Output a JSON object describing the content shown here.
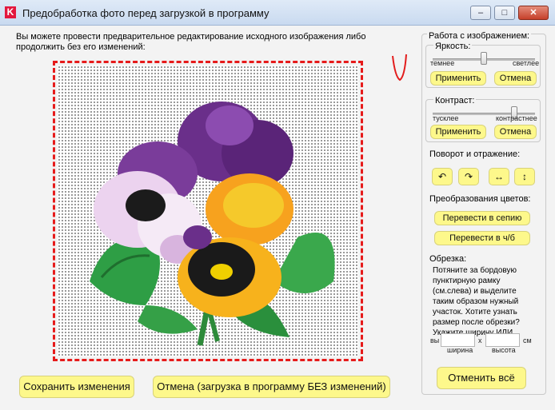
{
  "window": {
    "title": "Предобработка фото перед загрузкой в программу",
    "app_icon_letter": "K",
    "minimize_glyph": "–",
    "maximize_glyph": "□",
    "close_glyph": "✕"
  },
  "intro_text": "Вы можете провести предварительное редактирование исходного изображения либо продолжить без его изменений:",
  "bottom_buttons": {
    "save": "Сохранить изменения",
    "cancel": "Отмена (загрузка в программу БЕЗ изменений)"
  },
  "panel": {
    "title": "Работа с изображением:",
    "brightness": {
      "label": "Яркость:",
      "min_label": "темнее",
      "max_label": "светлее",
      "value": 0.5,
      "apply": "Применить",
      "cancel": "Отмена"
    },
    "contrast": {
      "label": "Контраст:",
      "min_label": "тусклее",
      "max_label": "контрастнее",
      "value": 0.8,
      "apply": "Применить",
      "cancel": "Отмена"
    },
    "rotation": {
      "label": "Поворот и отражение:",
      "rotate_left": "↶",
      "rotate_right": "↷",
      "flip_horizontal": "↔",
      "flip_vertical": "↕"
    },
    "colors": {
      "label": "Преобразования цветов:",
      "sepia": "Перевести в сепию",
      "grayscale": "Перевести в ч/б"
    },
    "crop": {
      "label": "Обрезка:",
      "help": "Потяните за бордовую пунктирную рамку (см.слева) и выделите таким образом нужный участок. Хотите узнать размер после обрезки? Укажите ширину ИЛИ",
      "prefix": "вы",
      "x_sign": "x",
      "unit": "см",
      "width_caption": "ширина",
      "height_caption": "высота",
      "width_value": "",
      "height_value": ""
    },
    "undo_all": "Отменить всё"
  },
  "colors": {
    "button_fill": "#fdf88b",
    "crop_frame": "#e61b1b",
    "app_icon": "#e3173e"
  }
}
